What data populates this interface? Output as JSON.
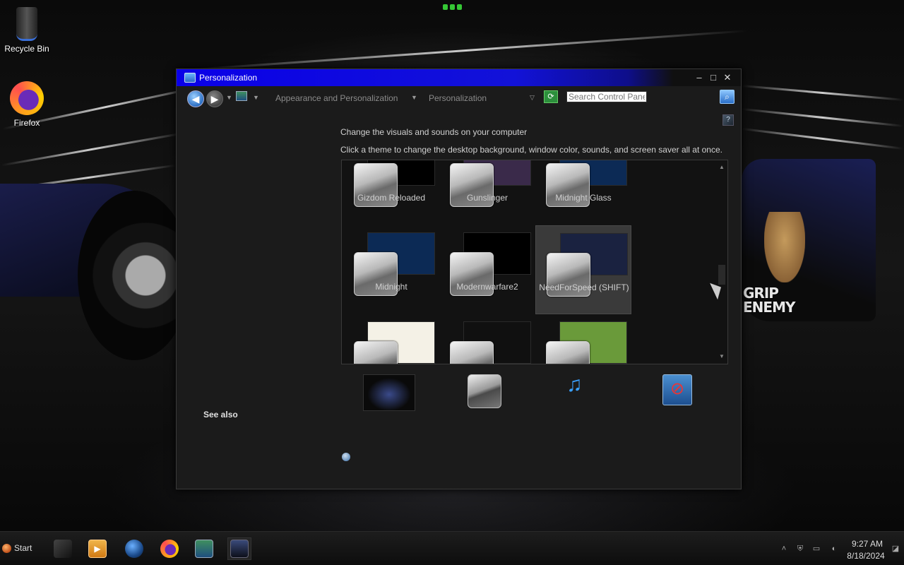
{
  "desktop": {
    "icons": [
      {
        "label": "Recycle Bin",
        "icon": "recycle-bin-icon"
      },
      {
        "label": "Firefox",
        "icon": "firefox-icon"
      }
    ],
    "wallpaper_text": "GRIP ENEMY"
  },
  "window": {
    "title": "Personalization",
    "controls": {
      "minimize": "–",
      "maximize": "□",
      "close": "✕"
    },
    "breadcrumb": [
      "Appearance and Personalization",
      "Personalization"
    ],
    "search": {
      "placeholder": "Search Control Panel"
    },
    "heading": "Change the visuals and sounds on your computer",
    "instruction": "Click a theme to change the desktop background, window color, sounds, and screen saver all at once.",
    "themes": [
      {
        "name": "Gizdom Reloaded",
        "preview_color": "#000000",
        "selected": false
      },
      {
        "name": "Gunslinger",
        "preview_color": "#3a2a4a",
        "selected": false
      },
      {
        "name": "Midnight Glass",
        "preview_color": "#0c2a55",
        "selected": false
      },
      {
        "name": "Midnight",
        "preview_color": "#0c2a55",
        "selected": false
      },
      {
        "name": "Modernwarfare2",
        "preview_color": "#000000",
        "selected": false
      },
      {
        "name": "NeedForSpeed (SHIFT)",
        "preview_color": "#1a2240",
        "selected": true
      },
      {
        "name": "",
        "preview_color": "#f4f1e6",
        "selected": false
      },
      {
        "name": "",
        "preview_color": "#101010",
        "selected": false
      },
      {
        "name": "",
        "preview_color": "#6a9a3a",
        "selected": false
      }
    ],
    "settings_row": [
      {
        "icon": "desktop-background-icon"
      },
      {
        "icon": "window-color-icon"
      },
      {
        "icon": "sounds-icon"
      },
      {
        "icon": "screen-saver-icon"
      }
    ],
    "see_also": "See also"
  },
  "taskbar": {
    "start_label": "Start",
    "apps": [
      {
        "icon": "file-explorer-icon"
      },
      {
        "icon": "media-player-icon"
      },
      {
        "icon": "internet-explorer-icon"
      },
      {
        "icon": "firefox-icon"
      },
      {
        "icon": "control-panel-icon"
      },
      {
        "icon": "personalization-icon"
      }
    ],
    "tray": [
      "show-hidden-icons",
      "security-icon",
      "network-icon",
      "update-icon"
    ],
    "clock": {
      "time": "9:27 AM",
      "date": "8/18/2024"
    }
  },
  "colors": {
    "titlebar_accent": "#1212d8",
    "window_bg": "#1b1b1b",
    "selected_theme_bg": "#3a3a3a"
  }
}
